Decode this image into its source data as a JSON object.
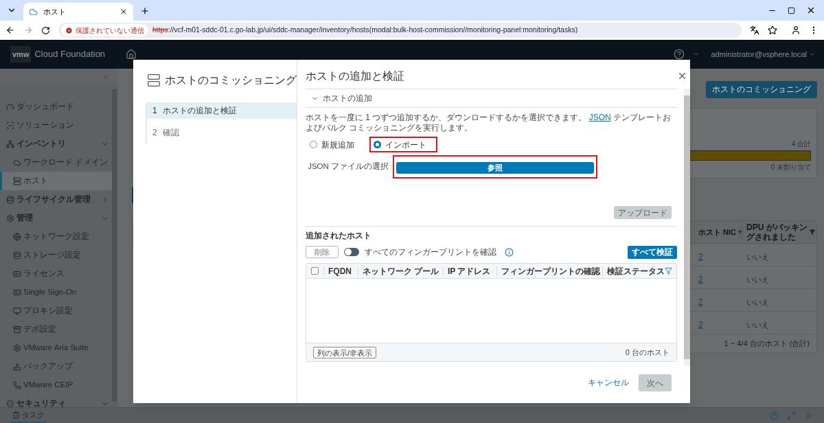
{
  "browser": {
    "tab_title": "ホスト",
    "security_label": "保護されていない通信",
    "url_scheme": "https",
    "url_rest": "://vcf-m01-sddc-01.c.go-lab.jp/ui/sddc-manager/inventory/hosts(modal:bulk-host-commission//monitoring-panel:monitoring/tasks)"
  },
  "app_header": {
    "logo": "vmw",
    "brand": "Cloud Foundation",
    "user": "administrator@vsphere.local"
  },
  "sidebar": {
    "items": [
      {
        "label": "ダッシュボード",
        "selected": false
      },
      {
        "label": "ソリューション",
        "selected": false
      },
      {
        "label": "インベントリ",
        "selected": false,
        "expanded": true,
        "children": [
          {
            "label": "ワークロード ドメイン",
            "selected": false
          },
          {
            "label": "ホスト",
            "selected": true
          }
        ]
      },
      {
        "label": "ライフサイクル管理",
        "selected": false,
        "expanded": false
      },
      {
        "label": "管理",
        "selected": false,
        "expanded": true,
        "children": [
          {
            "label": "ネットワーク設定",
            "selected": false
          },
          {
            "label": "ストレージ設定",
            "selected": false
          },
          {
            "label": "ライセンス",
            "selected": false
          },
          {
            "label": "Single Sign-On",
            "selected": false
          },
          {
            "label": "プロキシ設定",
            "selected": false
          },
          {
            "label": "デポ設定",
            "selected": false
          },
          {
            "label": "VMware Aria Suite",
            "selected": false
          },
          {
            "label": "バックアップ",
            "selected": false
          },
          {
            "label": "VMware CEIP",
            "selected": false
          }
        ]
      },
      {
        "label": "セキュリティ",
        "selected": false,
        "expanded": true
      }
    ]
  },
  "page": {
    "commission_button": "ホストのコミッショニング",
    "summary": {
      "total": "4 合計",
      "level": 1,
      "unassigned": "0 未割り当て"
    },
    "table": {
      "columns": [
        "ホスト NIC",
        "DPU がバッキングされました"
      ],
      "rows": [
        {
          "nic": "2",
          "dpu": "いいえ"
        },
        {
          "nic": "2",
          "dpu": "いいえ"
        },
        {
          "nic": "2",
          "dpu": "いいえ"
        },
        {
          "nic": "2",
          "dpu": "いいえ"
        }
      ],
      "footer": "1 ~ 4/4 台のホスト (合計)"
    }
  },
  "modal": {
    "title": "ホストのコミッショニング",
    "steps": [
      {
        "number": "1",
        "label": "ホストの追加と検証",
        "selected": true
      },
      {
        "number": "2",
        "label": "確認",
        "selected": false
      }
    ],
    "panel_title": "ホストの追加と検証",
    "accordion": {
      "label": "ホストの追加",
      "expanded": true
    },
    "description": {
      "before": "ホストを一度に 1 つずつ追加するか、ダウンロードするかを選択できます。",
      "link": "JSON",
      "after": "テンプレートおよびバルク コミッショニングを実行します。"
    },
    "options": [
      {
        "label": "新規追加",
        "selected": false,
        "highlighted": false
      },
      {
        "label": "インポート",
        "selected": true,
        "highlighted": true
      }
    ],
    "file_label": "JSON ファイルの選択",
    "browse_button": {
      "label": "参照",
      "highlighted": true
    },
    "upload_button": {
      "label": "アップロード",
      "disabled": true
    },
    "added_hosts": {
      "title": "追加されたホスト",
      "remove_button": {
        "label": "削除",
        "disabled": true
      },
      "toggle": {
        "label": "すべてのフィンガープリントを確認",
        "on": false
      },
      "verify_all_button": "すべて検証",
      "table": {
        "select_all_checked": false,
        "columns": [
          "FQDN",
          "ネットワーク プール",
          "IP アドレス",
          "フィンガープリントの確認",
          "検証ステータス"
        ],
        "columns_button": "列の表示/非表示",
        "count": "0 台のホスト"
      }
    },
    "cancel_button": "キャンセル",
    "next_button": {
      "label": "次へ",
      "disabled": true
    }
  },
  "task_bar": {
    "label": "タスク"
  }
}
